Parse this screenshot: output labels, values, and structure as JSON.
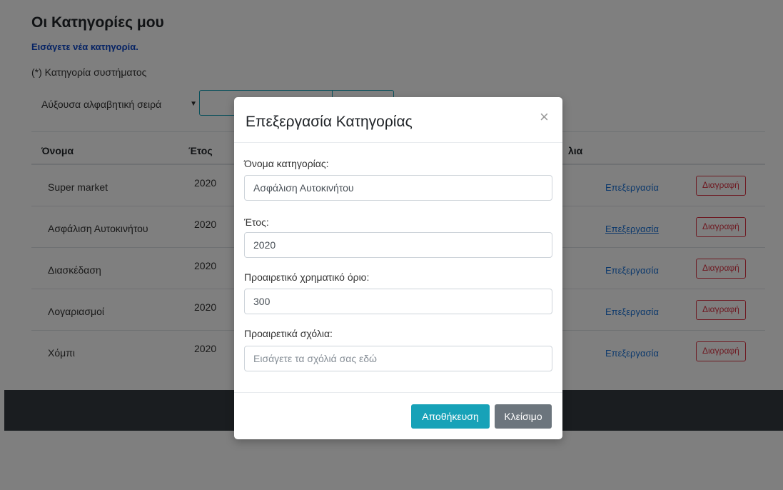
{
  "page": {
    "title": "Οι Κατηγορίες μου",
    "add_link": "Εισάγετε νέα κατηγορία.",
    "system_note": "(*) Κατηγορία συστήματος",
    "sort": {
      "selected": "Αύξουσα αλφαβητική σειρά"
    }
  },
  "table": {
    "headers": [
      "Όνομα",
      "Έτος",
      "λια"
    ],
    "rows": [
      {
        "name": "Super market",
        "year": "2020",
        "edit": "Επεξεργασία",
        "delete": "Διαγραφή"
      },
      {
        "name": "Ασφάλιση Αυτοκινήτου",
        "year": "2020",
        "edit": "Επεξεργασία",
        "delete": "Διαγραφή"
      },
      {
        "name": "Διασκέδαση",
        "year": "2020",
        "edit": "Επεξεργασία",
        "delete": "Διαγραφή"
      },
      {
        "name": "Λογαριασμοί",
        "year": "2020",
        "edit": "Επεξεργασία",
        "delete": "Διαγραφή"
      },
      {
        "name": "Χόμπι",
        "year": "2020",
        "edit": "Επεξεργασία",
        "delete": "Διαγραφή"
      }
    ]
  },
  "modal": {
    "title": "Επεξεργασία Κατηγορίας",
    "close_symbol": "×",
    "fields": {
      "name": {
        "label": "Όνομα κατηγορίας:",
        "value": "Ασφάλιση Αυτοκινήτου"
      },
      "year": {
        "label": "Έτος:",
        "value": "2020"
      },
      "limit": {
        "label": "Προαιρετικό χρηματικό όριο:",
        "value": "300"
      },
      "comments": {
        "label": "Προαιρετικά σχόλια:",
        "placeholder": "Εισάγετε τα σχόλιά σας εδώ"
      }
    },
    "save_label": "Αποθήκευση",
    "close_label": "Κλείσιμο"
  },
  "colors": {
    "accent": "#17a2b8",
    "danger": "#dc3545",
    "secondary": "#6c757d",
    "link": "#1a73d9"
  }
}
